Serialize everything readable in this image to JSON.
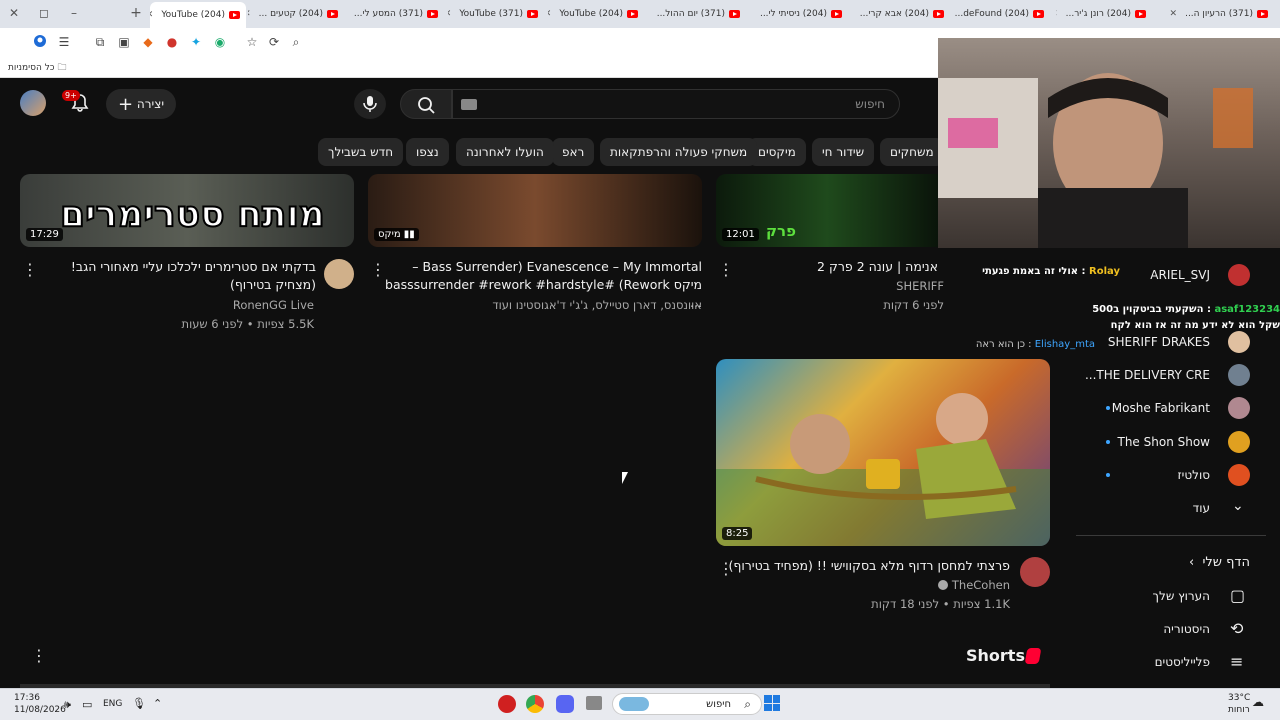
{
  "browser": {
    "tabs": [
      {
        "label": "(204) YouTube",
        "active": true
      },
      {
        "label": "(204) קטעים ...",
        "active": false
      },
      {
        "label": "(371) המסע לי...",
        "active": false
      },
      {
        "label": "(371) YouTube",
        "active": false
      },
      {
        "label": "(204) YouTube",
        "active": false
      },
      {
        "label": "(371) יום ההול...",
        "active": false
      },
      {
        "label": "(204) ניסיתי לי...",
        "active": false
      },
      {
        "label": "(204) אבא קרי...",
        "active": false
      },
      {
        "label": "(204) deFound...",
        "active": false
      },
      {
        "label": "(204) רונן ג'יר...",
        "active": false
      },
      {
        "label": "(371) הרעיון ה...",
        "active": false
      }
    ],
    "new_tab": "+",
    "bookmarks_label": "כל הסימניות"
  },
  "header": {
    "search_placeholder": "חיפוש",
    "create_label": "יצירה",
    "notification_count": "9+"
  },
  "chips": [
    "משחקים",
    "שידור חי",
    "מיקסים",
    "משחקי פעולה והרפתקאות",
    "ראפ",
    "הועלו לאחרונה",
    "נצפו",
    "חדש בשבילך"
  ],
  "videos": [
    {
      "title": "בדקתי אם סטרימרים ילכלכו עליי מאחורי הגב! (מצחיק בטירוף)",
      "channel": "RonenGG Live",
      "meta": "5.5K צפיות • לפני 6 שעות",
      "duration": "17:29",
      "thumb_text": "מותח סטרימרים"
    },
    {
      "title": "Evanescence – My Immortal (Bass Surrender – מיקס Rework)  #basssurrender #rework  #hardstyle ...",
      "channel": "אוונסנס, דארן סטיילס, ג'ג'י ד'אגוסטינו ועוד",
      "meta": "",
      "duration": "מיקס"
    },
    {
      "title": "אנימה | עונה 2 פרק 2",
      "channel": "SHERIFF",
      "meta": "לפני 6 דקות",
      "duration": "12:01",
      "thumb_text": "פרק"
    },
    {
      "title": "פרצתי למחסן רדוף מלא בסקווישי !! (מפחיד בטירוף)",
      "channel": "TheCohen",
      "meta": "1.1K צפיות • לפני 18 דקות",
      "duration": "8:25"
    }
  ],
  "shorts_label": "Shorts",
  "sidebar": {
    "subscriptions": [
      {
        "name": "ARIEL_SVJ"
      },
      {
        "name": "SHERIFF DRAKES"
      },
      {
        "name": "THE DELIVERY CRE..."
      },
      {
        "name": "Moshe Fabrikant"
      },
      {
        "name": "The Shon Show"
      },
      {
        "name": "סולטיז"
      }
    ],
    "more_label": "עוד",
    "you_label": "הדף שלי",
    "you_items": [
      "הערוץ שלך",
      "היסטוריה",
      "פלייליסטים"
    ]
  },
  "chat": [
    {
      "user": "Rolay",
      "text": "אולי זה באמת פגעתי"
    },
    {
      "user": "asaf123234",
      "text": "השקעתי בביטקוין ב500 שקל הוא לא ידע מה זה אז הוא לקח"
    },
    {
      "user": "Elishay_mta",
      "text": "כן הוא ראה"
    }
  ],
  "taskbar": {
    "time": "17:36",
    "date": "11/08/2026",
    "lang": "ENG",
    "weather_temp": "33°C",
    "weather_label": "רוחות",
    "search_label": "חיפוש"
  },
  "colors": {
    "accent": "#ff0000",
    "bg": "#0f0f0f",
    "chip": "#272727",
    "link": "#3ea6ff"
  }
}
